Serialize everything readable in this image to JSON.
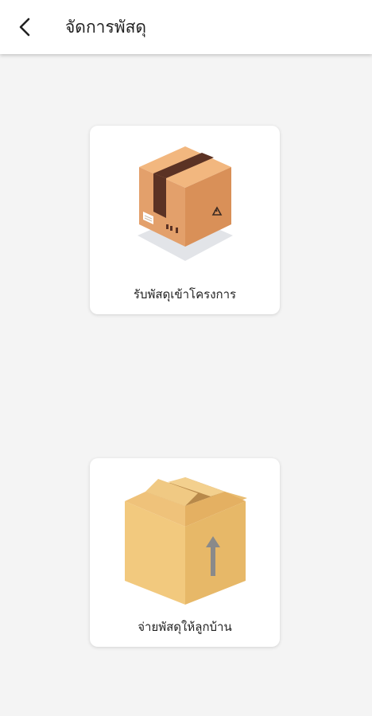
{
  "header": {
    "title": "จัดการพัสดุ",
    "back_icon": "chevron-left-icon"
  },
  "actions": [
    {
      "label": "รับพัสดุเข้าโครงการ",
      "icon": "parcel-box-taped-icon"
    },
    {
      "label": "จ่ายพัสดุให้ลูกบ้าน",
      "icon": "open-box-up-arrow-icon"
    }
  ],
  "colors": {
    "background": "#f4f4f4",
    "card": "#ffffff",
    "box_tan": "#e9a56a",
    "box_yellow": "#efc77a",
    "tape": "#5b3224",
    "arrow": "#8a8a8a"
  }
}
